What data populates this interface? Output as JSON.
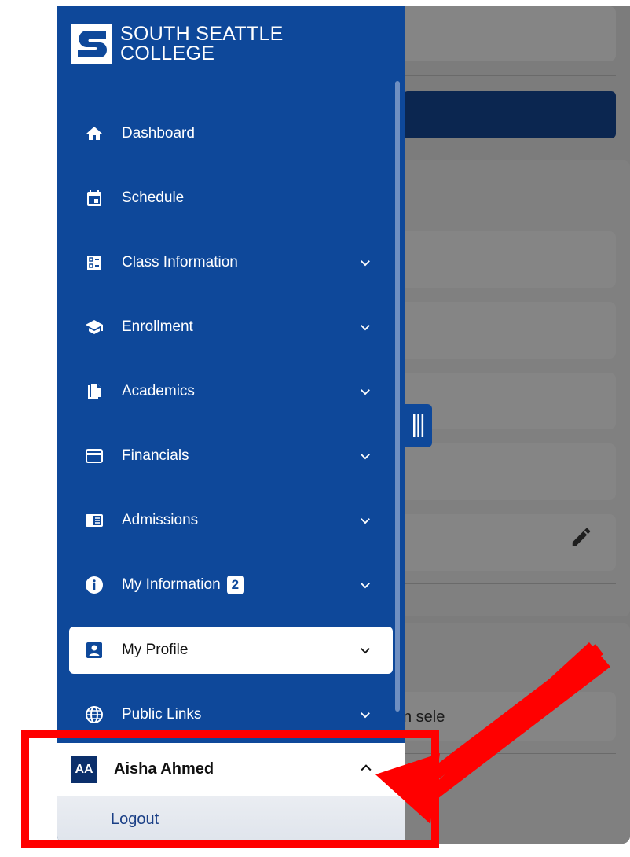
{
  "brand": {
    "line1": "SOUTH SEATTLE",
    "line2": "COLLEGE"
  },
  "nav": [
    {
      "label": "Dashboard",
      "icon": "home-icon",
      "expandable": false
    },
    {
      "label": "Schedule",
      "icon": "calendar-icon",
      "expandable": false
    },
    {
      "label": "Class Information",
      "icon": "class-info-icon",
      "expandable": true
    },
    {
      "label": "Enrollment",
      "icon": "graduation-cap-icon",
      "expandable": true
    },
    {
      "label": "Academics",
      "icon": "documents-icon",
      "expandable": true
    },
    {
      "label": "Financials",
      "icon": "credit-card-icon",
      "expandable": true
    },
    {
      "label": "Admissions",
      "icon": "admissions-icon",
      "expandable": true
    },
    {
      "label": "My Information",
      "icon": "info-icon",
      "expandable": true,
      "badge": "2"
    },
    {
      "label": "My Profile",
      "icon": "profile-icon",
      "expandable": true,
      "active": true
    },
    {
      "label": "Public Links",
      "icon": "globe-icon",
      "expandable": true
    }
  ],
  "user": {
    "initials": "AA",
    "name": "Aisha Ahmed",
    "logout_label": "Logout"
  },
  "background": {
    "partial_text": "n sele"
  },
  "colors": {
    "sidebar": "#0e489a",
    "annotation": "#ff0000",
    "avatar": "#0b2f6b"
  }
}
